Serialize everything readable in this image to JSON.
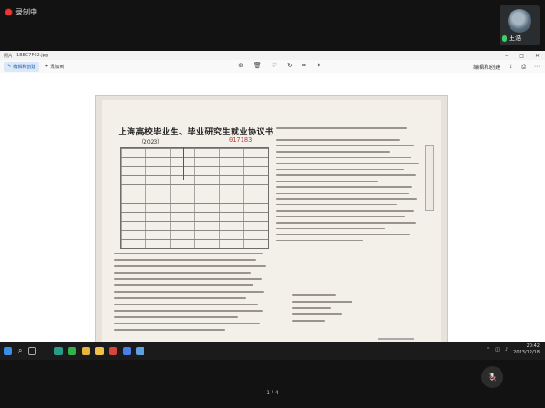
{
  "meeting": {
    "record_label": "录制中",
    "participant_name": "王浩"
  },
  "viewer": {
    "app_name": "照片",
    "file_name": "1BEC7F02.jpg",
    "edit_button": "编辑和创建",
    "add_button": "添加到",
    "toolbar_right_label": "编辑和创建"
  },
  "document": {
    "title": "上海高校毕业生、毕业研究生就业协议书",
    "year": "（2023）",
    "serial": "017183"
  },
  "page_indicator": "1 / 4",
  "taskbar": {
    "time": "20:42",
    "date": "2023/12/18"
  }
}
